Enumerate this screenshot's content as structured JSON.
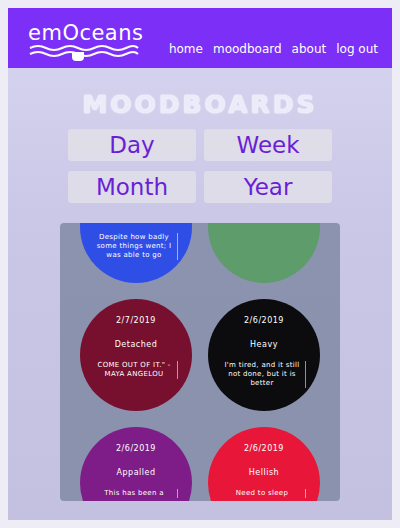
{
  "logo": {
    "text": "emOceans"
  },
  "nav": [
    "home",
    "moodboard",
    "about",
    "log out"
  ],
  "title": "MOODBOARDS",
  "ranges": [
    {
      "label": "Day",
      "selected": false
    },
    {
      "label": "Week",
      "selected": false
    },
    {
      "label": "Month",
      "selected": false
    },
    {
      "label": "Year",
      "selected": false
    }
  ],
  "moods": [
    {
      "date": "",
      "mood": "",
      "note": "Despite how badly some things went; I was able to go",
      "color": "#2f4ee6"
    },
    {
      "date": "",
      "mood": "",
      "note": "",
      "color": "#5e9c6c"
    },
    {
      "date": "2/7/2019",
      "mood": "Detached",
      "note": "COME OUT OF IT.\" - MAYA ANGELOU",
      "color": "#76102e"
    },
    {
      "date": "2/6/2019",
      "mood": "Heavy",
      "note": "I'm tired, and it still not done, but it is better",
      "color": "#0c0c0e"
    },
    {
      "date": "2/6/2019",
      "mood": "Appalled",
      "note": "This has been a",
      "color": "#7e1c88"
    },
    {
      "date": "2/6/2019",
      "mood": "Hellish",
      "note": "Need to sleep",
      "color": "#e8173a"
    }
  ]
}
